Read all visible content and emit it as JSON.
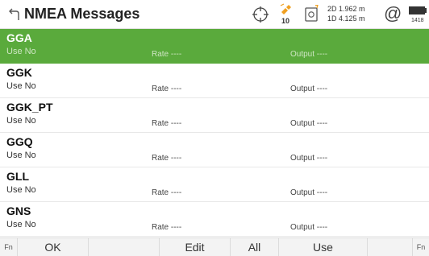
{
  "header": {
    "title": "NMEA Messages",
    "satellites": "10",
    "precision_2d": "2D 1.962 m",
    "precision_1d": "1D 4.125 m",
    "clock": "1418"
  },
  "messages": [
    {
      "name": "GGA",
      "use": "Use  No",
      "rate": "Rate ----",
      "output": "Output ----",
      "selected": true
    },
    {
      "name": "GGK",
      "use": "Use  No",
      "rate": "Rate ----",
      "output": "Output ----",
      "selected": false
    },
    {
      "name": "GGK_PT",
      "use": "Use  No",
      "rate": "Rate ----",
      "output": "Output ----",
      "selected": false
    },
    {
      "name": "GGQ",
      "use": "Use  No",
      "rate": "Rate ----",
      "output": "Output ----",
      "selected": false
    },
    {
      "name": "GLL",
      "use": "Use  No",
      "rate": "Rate ----",
      "output": "Output ----",
      "selected": false
    },
    {
      "name": "GNS",
      "use": "Use  No",
      "rate": "Rate ----",
      "output": "Output ----",
      "selected": false
    }
  ],
  "footer": {
    "fn_left": "Fn",
    "ok": "OK",
    "edit": "Edit",
    "all": "All",
    "use": "Use",
    "fn_right": "Fn"
  },
  "colors": {
    "selected_row": "#5aaa3c",
    "accent_orange": "#f0a020"
  }
}
